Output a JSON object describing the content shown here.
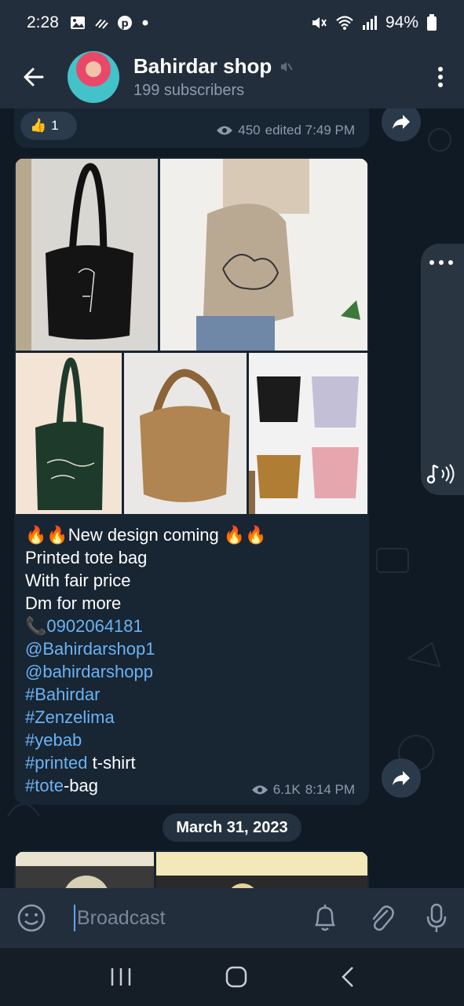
{
  "status_bar": {
    "time": "2:28",
    "battery": "94%",
    "icons_left": [
      "image-icon",
      "signal-waves-icon",
      "pinterest-icon",
      "dot-icon"
    ],
    "icons_right": [
      "mute-icon",
      "wifi-icon",
      "cell-signal-icon",
      "battery-icon"
    ]
  },
  "header": {
    "title": "Bahirdar shop",
    "subtitle": "199 subscribers",
    "muted": true
  },
  "messages": [
    {
      "reaction_emoji": "👍",
      "reaction_count": "1",
      "views": "450",
      "time": "edited 7:49 PM"
    },
    {
      "lines": [
        {
          "text": "🔥🔥New design coming 🔥🔥",
          "link": false
        },
        {
          "text": "Printed  tote bag",
          "link": false
        },
        {
          "text": "With fair  price",
          "link": false
        },
        {
          "text": "Dm for more",
          "link": false
        }
      ],
      "phone_emoji": "📞",
      "phone": "0902064181",
      "mentions": [
        "@Bahirdarshop1",
        "@bahirdarshopp"
      ],
      "hashtags": [
        "#Bahirdar",
        "#Zenzelima",
        "#yebab"
      ],
      "hashtag_printed": "#printed",
      "printed_suffix": " t-shirt",
      "hashtag_tote": "#tote",
      "tote_suffix": "-bag",
      "views": "6.1K",
      "time": "8:14 PM"
    }
  ],
  "date_separator": "March 31, 2023",
  "input": {
    "placeholder": "Broadcast"
  },
  "colors": {
    "header_bg": "#232e3c",
    "bubble_bg": "#182533",
    "link": "#6ab3f3",
    "meta": "#8d9bab"
  }
}
